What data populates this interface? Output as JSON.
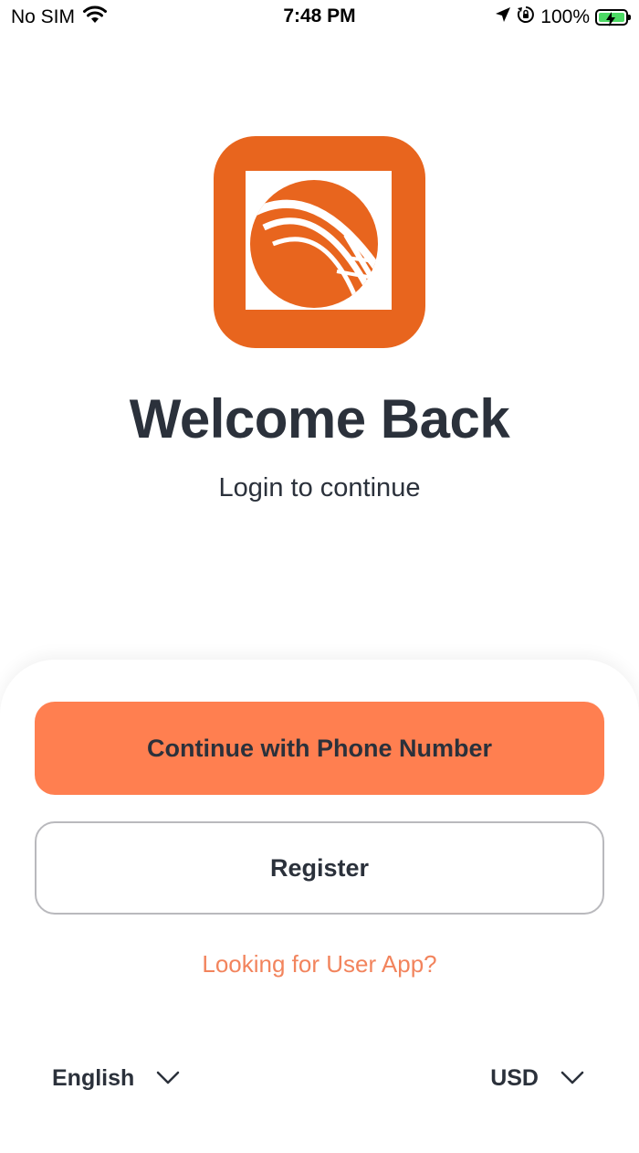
{
  "status_bar": {
    "carrier": "No SIM",
    "time": "7:48 PM",
    "battery": "100%",
    "battery_level": 1.0,
    "battery_color": "#4cd964"
  },
  "header": {
    "title": "Welcome Back",
    "subtitle": "Login to continue"
  },
  "brand": {
    "logo_color": "#e8651e",
    "accent_color": "#ff7f50",
    "link_color": "#f2845d"
  },
  "actions": {
    "phone_button_label": "Continue with Phone Number",
    "register_button_label": "Register",
    "user_app_link": "Looking for User App?"
  },
  "footer": {
    "language": "English",
    "currency": "USD"
  },
  "icons": {
    "wifi": "wifi-icon",
    "location": "location-arrow-icon",
    "rotation_lock": "rotation-lock-icon",
    "battery": "battery-icon",
    "chevron": "chevron-down-icon"
  }
}
